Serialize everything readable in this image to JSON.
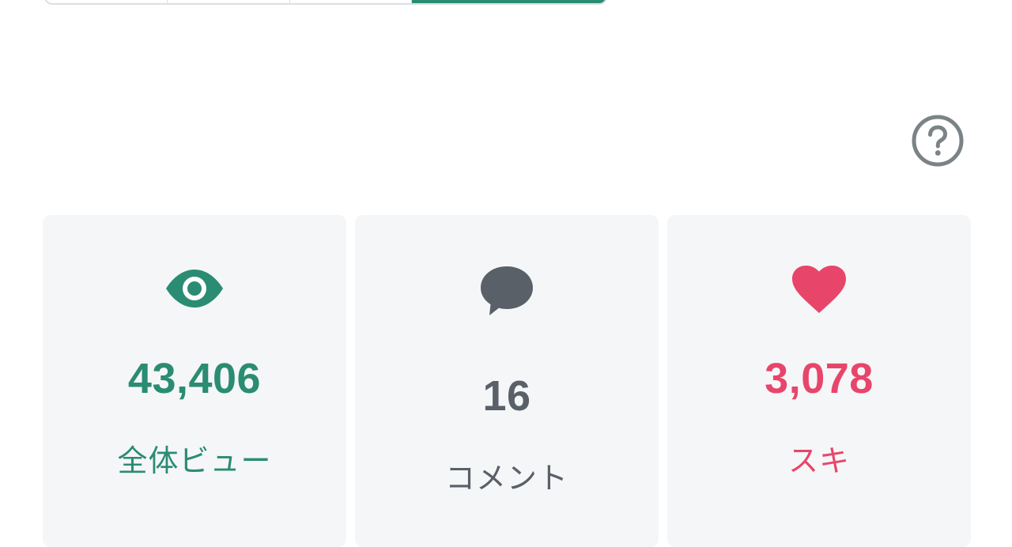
{
  "colors": {
    "accent_green": "#2a8c73",
    "comment_gray": "#5a6068",
    "like_pink": "#e8456a",
    "help_gray": "#7b8387",
    "card_bg": "#f5f6f8"
  },
  "period_selector": {
    "segments": 4,
    "active_index": 3
  },
  "help": {
    "icon": "question-circle-icon"
  },
  "stats": {
    "views": {
      "icon": "eye-icon",
      "value": "43,406",
      "label": "全体ビュー"
    },
    "comments": {
      "icon": "speech-bubble-icon",
      "value": "16",
      "label": "コメント"
    },
    "likes": {
      "icon": "heart-icon",
      "value": "3,078",
      "label": "スキ"
    }
  }
}
